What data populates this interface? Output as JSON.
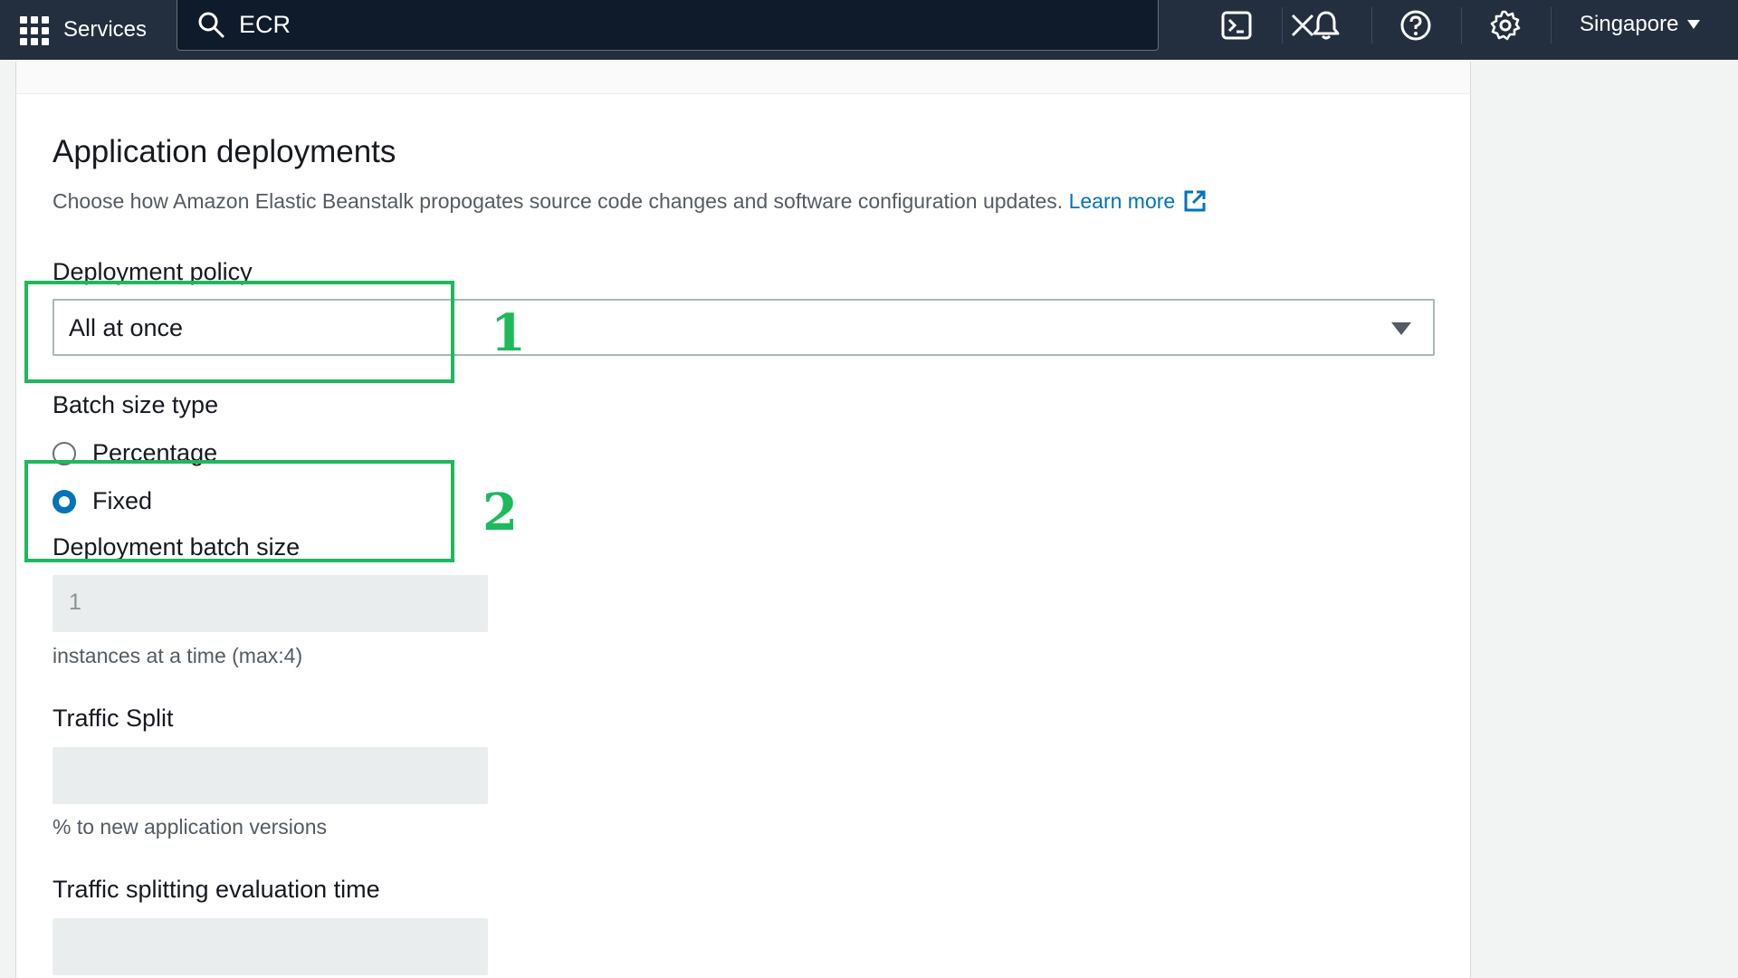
{
  "topnav": {
    "services_label": "Services",
    "search_value": "ECR",
    "region_label": "Singapore",
    "icons": [
      "cloudshell-icon",
      "notifications-icon",
      "help-icon",
      "settings-icon"
    ]
  },
  "section": {
    "title": "Application deployments",
    "description": "Choose how Amazon Elastic Beanstalk propogates source code changes and software configuration updates.",
    "learn_more": "Learn more"
  },
  "deployment_policy": {
    "label": "Deployment policy",
    "selected": "All at once"
  },
  "batch_size_type": {
    "label": "Batch size type",
    "options": [
      {
        "label": "Percentage",
        "checked": false
      },
      {
        "label": "Fixed",
        "checked": true
      }
    ]
  },
  "deployment_batch_size": {
    "label": "Deployment batch size",
    "value": "1",
    "hint": "instances at a time (max:4)"
  },
  "traffic_split": {
    "label": "Traffic Split",
    "value": "",
    "hint": "% to new application versions"
  },
  "traffic_eval_time": {
    "label": "Traffic splitting evaluation time",
    "value": ""
  },
  "annotations": [
    "1",
    "2"
  ],
  "colors": {
    "nav_bg": "#232f3e",
    "link": "#0073bb",
    "annotation": "#1db95b",
    "radio_checked": "#0073bb"
  }
}
